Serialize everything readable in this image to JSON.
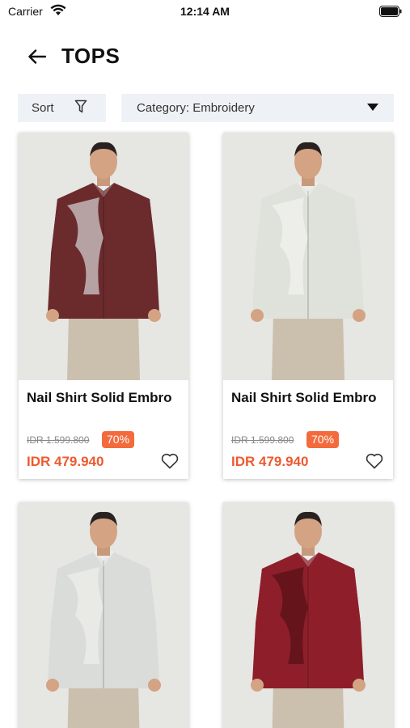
{
  "status_bar": {
    "carrier": "Carrier",
    "time": "12:14 AM"
  },
  "header": {
    "title": "TOPS"
  },
  "filters": {
    "sort_label": "Sort",
    "category_label": "Category: Embroidery"
  },
  "products": [
    {
      "name": "Nail Shirt Solid Embro",
      "old_price": "IDR 1.599.800",
      "discount": "70%",
      "price": "IDR 479.940",
      "shirt_color": "#6b2a2c",
      "pattern_color": "#c9bfc2"
    },
    {
      "name": "Nail Shirt Solid Embro",
      "old_price": "IDR 1.599.800",
      "discount": "70%",
      "price": "IDR 479.940",
      "shirt_color": "#dfe2da",
      "pattern_color": "#f0f1ec"
    },
    {
      "name": "",
      "old_price": "",
      "discount": "",
      "price": "",
      "shirt_color": "#d9dcd8",
      "pattern_color": "#eceeea"
    },
    {
      "name": "",
      "old_price": "",
      "discount": "",
      "price": "",
      "shirt_color": "#8e1f2a",
      "pattern_color": "#5c1219"
    }
  ],
  "colors": {
    "accent": "#ee5a2e",
    "badge": "#f36b3d",
    "filter_bg": "#eef2f6"
  }
}
